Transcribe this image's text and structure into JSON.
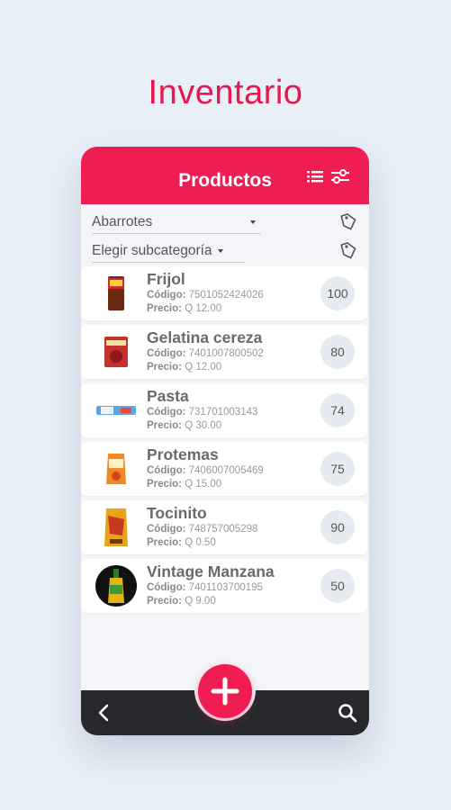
{
  "headline": "Inventario",
  "appbar": {
    "title": "Productos"
  },
  "filters": {
    "category": "Abarrotes",
    "subcategory": "Elegir subcategoría"
  },
  "products": [
    {
      "name": "Frijol",
      "code_label": "Código:",
      "code": "7501052424026",
      "price_label": "Precio:",
      "price": "Q 12.00",
      "qty": "100"
    },
    {
      "name": "Gelatina cereza",
      "code_label": "Código:",
      "code": "7401007800502",
      "price_label": "Precio:",
      "price": "Q 12.00",
      "qty": "80"
    },
    {
      "name": "Pasta",
      "code_label": "Código:",
      "code": "731701003143",
      "price_label": "Precio:",
      "price": "Q 30.00",
      "qty": "74"
    },
    {
      "name": "Protemas",
      "code_label": "Código:",
      "code": "7406007005469",
      "price_label": "Precio:",
      "price": "Q 15.00",
      "qty": "75"
    },
    {
      "name": "Tocinito",
      "code_label": "Código:",
      "code": "748757005298",
      "price_label": "Precio:",
      "price": "Q 0.50",
      "qty": "90"
    },
    {
      "name": "Vintage Manzana",
      "code_label": "Código:",
      "code": "7401103700195",
      "price_label": "Precio:",
      "price": "Q 9.00",
      "qty": "50"
    }
  ],
  "icons": {
    "list": "list-icon",
    "filter": "sliders-icon",
    "tag": "tag-icon",
    "back": "chevron-left-icon",
    "search": "search-icon",
    "add": "plus-icon"
  },
  "colors": {
    "accent": "#ef1d52",
    "bottombar": "#26282c",
    "background": "#e9eff7"
  }
}
